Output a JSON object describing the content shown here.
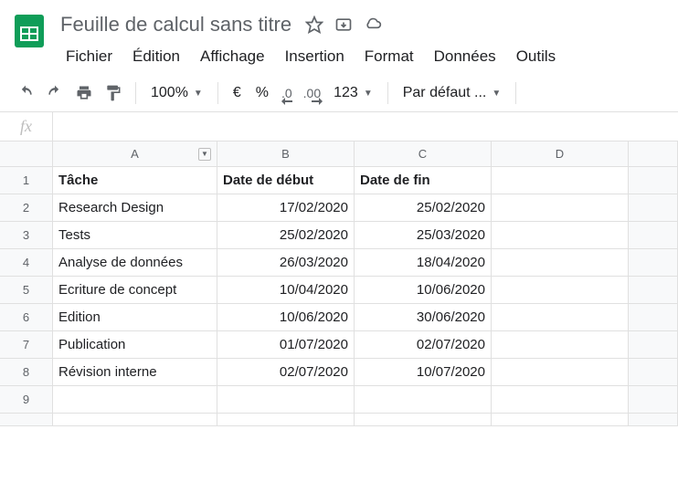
{
  "doc": {
    "title": "Feuille de calcul sans titre"
  },
  "menu": {
    "file": "Fichier",
    "edit": "Édition",
    "view": "Affichage",
    "insert": "Insertion",
    "format": "Format",
    "data": "Données",
    "tools": "Outils"
  },
  "toolbar": {
    "zoom": "100%",
    "currency": "€",
    "percent": "%",
    "dec_less": ".0",
    "dec_more": ".00",
    "num_fmt": "123",
    "font": "Par défaut ..."
  },
  "fx": {
    "label": "fx"
  },
  "cols": {
    "a": "A",
    "b": "B",
    "c": "C",
    "d": "D"
  },
  "rows": [
    "1",
    "2",
    "3",
    "4",
    "5",
    "6",
    "7",
    "8",
    "9"
  ],
  "headers": {
    "task": "Tâche",
    "start": "Date de début",
    "end": "Date de fin"
  },
  "data": [
    {
      "task": "Research Design",
      "start": "17/02/2020",
      "end": "25/02/2020"
    },
    {
      "task": "Tests",
      "start": "25/02/2020",
      "end": "25/03/2020"
    },
    {
      "task": "Analyse de données",
      "start": "26/03/2020",
      "end": "18/04/2020"
    },
    {
      "task": "Ecriture de concept",
      "start": "10/04/2020",
      "end": "10/06/2020"
    },
    {
      "task": "Edition",
      "start": "10/06/2020",
      "end": "30/06/2020"
    },
    {
      "task": "Publication",
      "start": "01/07/2020",
      "end": "02/07/2020"
    },
    {
      "task": "Révision interne",
      "start": "02/07/2020",
      "end": "10/07/2020"
    }
  ]
}
